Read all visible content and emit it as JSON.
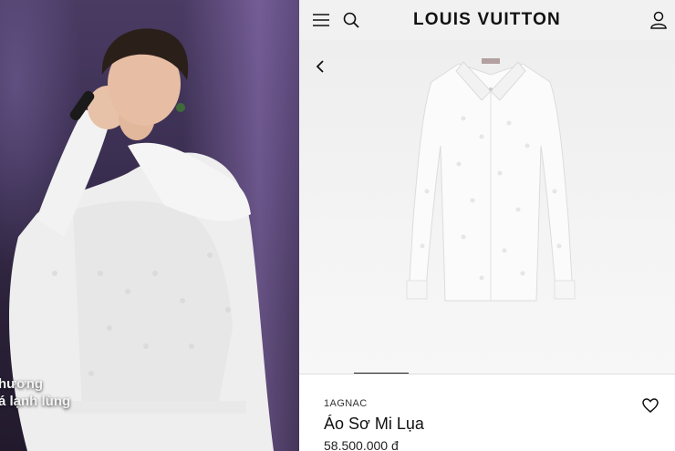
{
  "photo": {
    "caption_line1": "hương",
    "caption_line2": "á lạnh lùng"
  },
  "header": {
    "brand": "LOUIS VUITTON",
    "icons": [
      "menu-icon",
      "search-icon",
      "account-icon"
    ]
  },
  "gallery": {
    "back_icon": "chevron-left-icon",
    "image": "white silk monogram shirt"
  },
  "product": {
    "sku": "1AGNAC",
    "name": "Áo Sơ Mi Lụa",
    "price": "58.500.000 đ",
    "wishlist_icon": "heart-icon"
  },
  "colors": {
    "topbar": "#f1f1f1",
    "text": "#111111",
    "stage": "#3b2f52"
  }
}
